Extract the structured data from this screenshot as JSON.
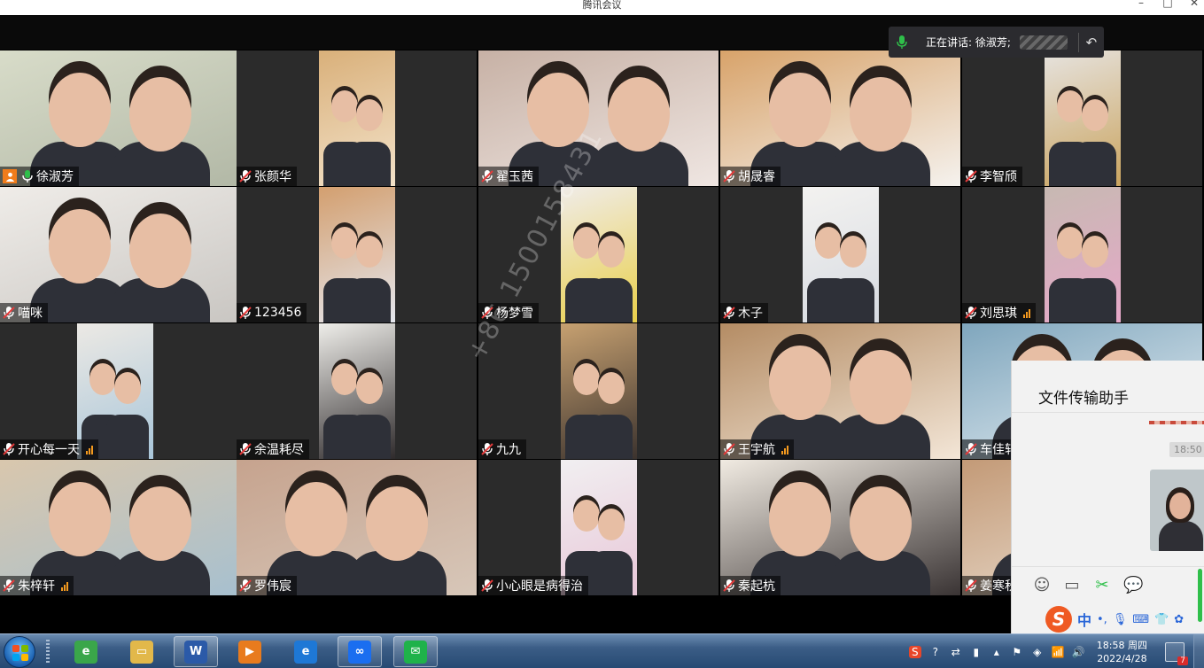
{
  "window": {
    "title": "腾讯会议",
    "minimize": "–",
    "maximize": "□",
    "close": "✕"
  },
  "speaking": {
    "label": "正在讲话: 徐淑芳;",
    "back_icon": "undo-arrow-icon"
  },
  "watermark": "+86 1500158431",
  "participants": [
    {
      "name": "徐淑芳",
      "host": true,
      "mic": "on",
      "speaking": true,
      "signal": 0,
      "colors": [
        "#d8dcc9",
        "#b2b8a6"
      ]
    },
    {
      "name": "张颜华",
      "mic": "off",
      "signal": 0,
      "colors": [
        "#d9b07a",
        "#f3e2c9"
      ]
    },
    {
      "name": "翟玉茜",
      "mic": "off",
      "signal": 0,
      "colors": [
        "#c7b1a5",
        "#efe6e2"
      ]
    },
    {
      "name": "胡晟睿",
      "mic": "off",
      "signal": 0,
      "colors": [
        "#d8a36a",
        "#f5f2ee"
      ]
    },
    {
      "name": "李智颀",
      "mic": "off",
      "signal": 0,
      "colors": [
        "#e6e3df",
        "#caa45f"
      ]
    },
    {
      "name": "喵咪",
      "mic": "off",
      "signal": 0,
      "colors": [
        "#efece8",
        "#c9c6c2"
      ]
    },
    {
      "name": "123456",
      "mic": "off",
      "signal": 0,
      "colors": [
        "#d39f6f",
        "#e5e7ee"
      ]
    },
    {
      "name": "杨梦雪",
      "mic": "off",
      "signal": 0,
      "colors": [
        "#f0ece8",
        "#e9cf4a"
      ]
    },
    {
      "name": "木子",
      "mic": "off",
      "signal": 0,
      "colors": [
        "#f3f2f0",
        "#d7dbe2"
      ]
    },
    {
      "name": "刘思琪",
      "mic": "off",
      "signal": 3,
      "colors": [
        "#c7b9b2",
        "#e6a8c9"
      ]
    },
    {
      "name": "开心每一天",
      "mic": "off",
      "signal": 3,
      "colors": [
        "#ece9e4",
        "#a9c6da"
      ]
    },
    {
      "name": "余温耗尽",
      "mic": "off",
      "signal": 0,
      "colors": [
        "#efeeea",
        "#2f2b2c"
      ]
    },
    {
      "name": "九九",
      "mic": "off",
      "signal": 0,
      "colors": [
        "#c7a171",
        "#3c332e"
      ]
    },
    {
      "name": "王宇航",
      "mic": "off",
      "signal": 3,
      "colors": [
        "#b48c64",
        "#f3e6d7"
      ]
    },
    {
      "name": "车佳轩",
      "mic": "off",
      "signal": 0,
      "colors": [
        "#7fa6bd",
        "#e6eef3"
      ]
    },
    {
      "name": "朱梓轩",
      "mic": "off",
      "signal": 3,
      "colors": [
        "#d9c7ad",
        "#a7c0cf"
      ]
    },
    {
      "name": "罗伟宸",
      "mic": "off",
      "signal": 0,
      "colors": [
        "#c6a38e",
        "#d7c7b9"
      ]
    },
    {
      "name": "小心眼是病得治",
      "mic": "off",
      "signal": 0,
      "colors": [
        "#f1eff1",
        "#e8c7d8"
      ]
    },
    {
      "name": "秦起杭",
      "mic": "off",
      "signal": 0,
      "colors": [
        "#f1ebe2",
        "#3a3434"
      ]
    },
    {
      "name": "姜寒秋",
      "mic": "off",
      "signal": 0,
      "colors": [
        "#c39a77",
        "#ece1d4"
      ]
    }
  ],
  "chat": {
    "title": "文件传输助手",
    "timestamp": "18:50",
    "tools": [
      "smiley-icon",
      "folder-icon",
      "scissors-icon",
      "chat-bubble-icon"
    ]
  },
  "ime": {
    "logo": "S",
    "lang": "中"
  },
  "taskbar": {
    "apps": [
      {
        "id": "browser-360",
        "label": "e",
        "color": "#3aa64a",
        "open": false
      },
      {
        "id": "file-explorer",
        "label": "▭",
        "color": "#e2b84a",
        "open": false
      },
      {
        "id": "word",
        "label": "W",
        "color": "#2b5aa8",
        "open": true
      },
      {
        "id": "media-player",
        "label": "▶",
        "color": "#e87b1e",
        "open": false
      },
      {
        "id": "ie",
        "label": "e",
        "color": "#1e78d6",
        "open": false
      },
      {
        "id": "tencent-meeting",
        "label": "∞",
        "color": "#1a6ef0",
        "open": true
      },
      {
        "id": "wechat",
        "label": "✉",
        "color": "#1fb24a",
        "open": true
      }
    ],
    "clock_time": "18:58 周四",
    "clock_date": "2022/4/28",
    "notify_count": "7"
  }
}
